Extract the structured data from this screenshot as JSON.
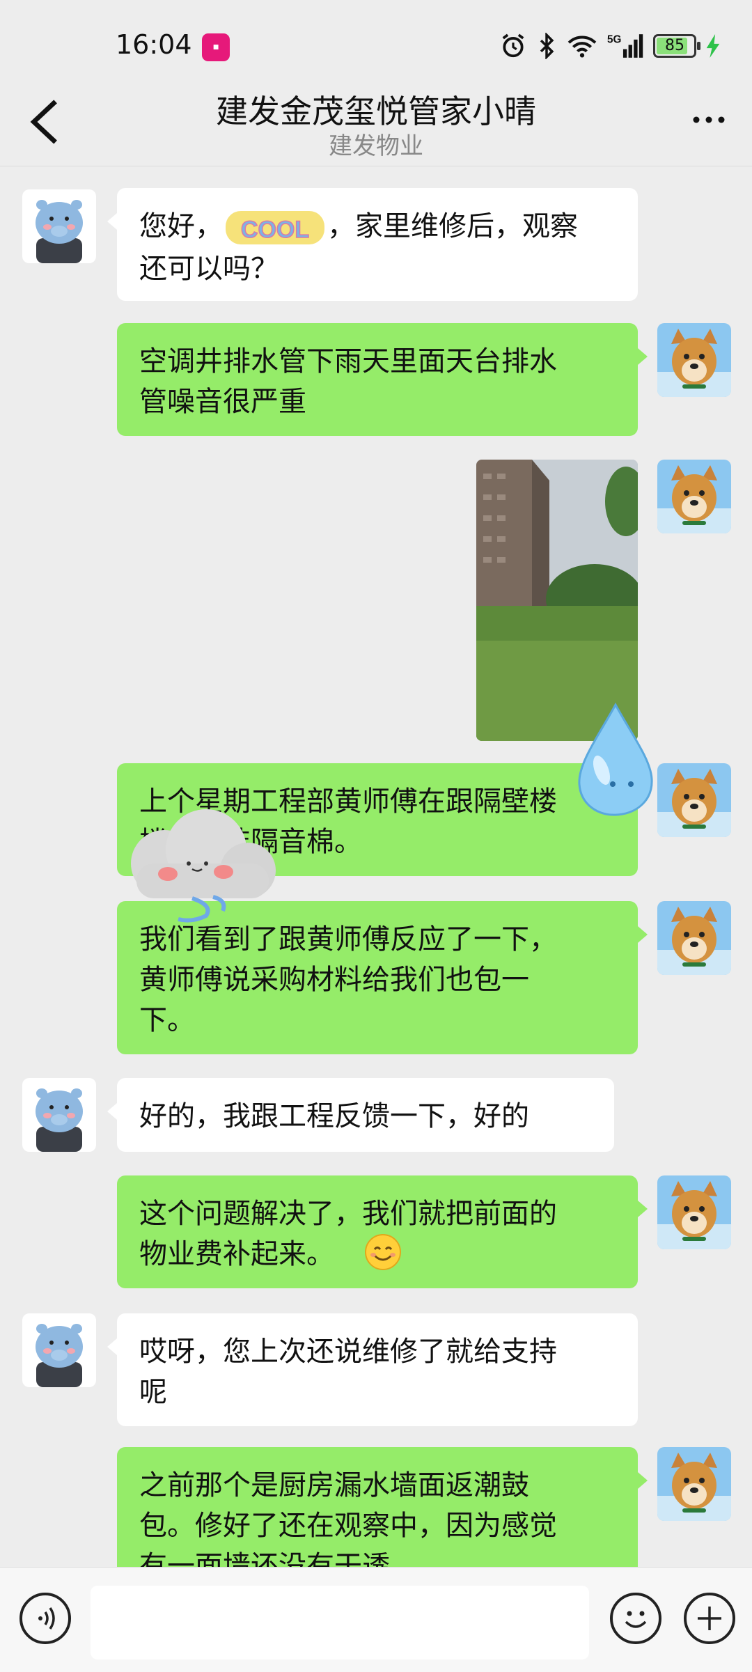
{
  "status_bar": {
    "time": "16:04",
    "battery": "85",
    "network": "5G"
  },
  "header": {
    "title": "建发金茂玺悦管家小晴",
    "subtitle": "建发物业"
  },
  "messages": [
    {
      "from": "other",
      "text_before": "您好，",
      "sticker": "COOL",
      "text_after": "，家里维修后，观察\n还可以吗？"
    },
    {
      "from": "me",
      "text": "空调井排水管下雨天里面天台排水\n管噪音很严重"
    },
    {
      "from": "me",
      "type": "image",
      "alt": "photo of building and lawn"
    },
    {
      "from": "me",
      "text": "上个星期工程部黄师傅在跟隔壁楼\n楼上的装隔音棉。"
    },
    {
      "from": "me",
      "text": "我们看到了跟黄师傅反应了一下，\n黄师傅说采购材料给我们也包一\n下。"
    },
    {
      "from": "other",
      "text": "好的，我跟工程反馈一下，好的"
    },
    {
      "from": "me",
      "text": "这个问题解决了，我们就把前面的\n物业费补起来。",
      "emoji": "smile"
    },
    {
      "from": "other",
      "text": "哎呀，您上次还说维修了就给支持\n呢"
    },
    {
      "from": "me",
      "text": "之前那个是厨房漏水墙面返潮鼓\n包。修好了还在观察中，因为感觉\n有一面墙还没有干透"
    }
  ],
  "colors": {
    "background": "#ededed",
    "bubble_out": "#95ec69",
    "bubble_in": "#ffffff"
  }
}
